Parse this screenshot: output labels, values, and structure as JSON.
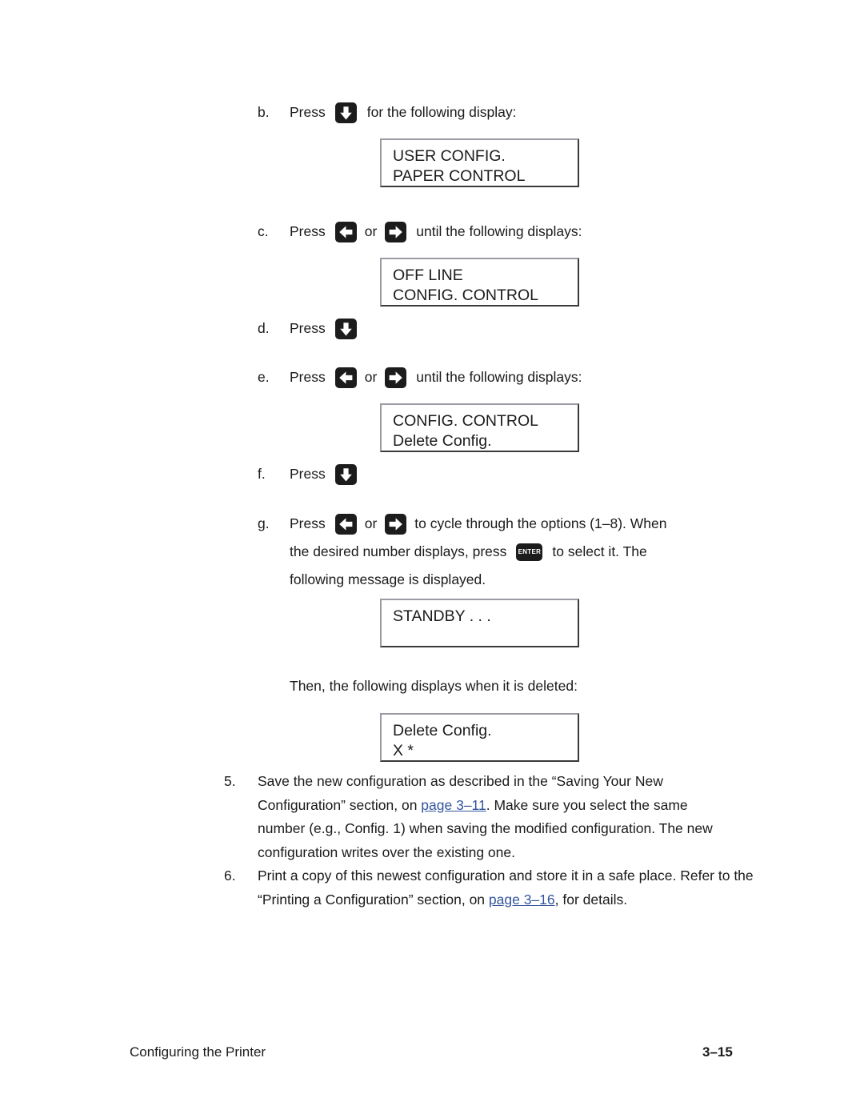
{
  "page": {
    "footer_left": "Configuring the Printer",
    "footer_right": "3–15"
  },
  "icons": {
    "down_arrow": "arrow-down-key-icon",
    "left_arrow": "arrow-left-key-icon",
    "right_arrow": "arrow-right-key-icon",
    "enter": "enter-key-icon",
    "enter_label": "ENTER"
  },
  "steps": {
    "b": {
      "marker": "b.",
      "text_before": "Press",
      "text_after": "for the following display:"
    },
    "c": {
      "marker": "c.",
      "text_before": "Press",
      "text_or": "or",
      "text_after": "until the following displays:"
    },
    "d": {
      "marker": "d.",
      "text_before": "Press"
    },
    "e": {
      "marker": "e.",
      "text_before": "Press",
      "text_or": "or",
      "text_after": "until the following displays:"
    },
    "f": {
      "marker": "f.",
      "text_before": "Press"
    },
    "g": {
      "marker": "g.",
      "text_before": "Press",
      "text_or": "or",
      "text_after": "to cycle through the options (1–8). When",
      "line2_before": "the desired number displays, press",
      "line2_after": "to select it. The",
      "line3": "following message is displayed."
    }
  },
  "displays": {
    "user_config": {
      "line1": "USER CONFIG.",
      "line2": "PAPER CONTROL"
    },
    "off_line": {
      "line1": "OFF LINE",
      "line2": "CONFIG. CONTROL"
    },
    "config_control": {
      "line1": "CONFIG. CONTROL",
      "line2": "Delete Config."
    },
    "standby": {
      "line1": "STANDBY . . .",
      "line2": ""
    },
    "delete_config": {
      "line1": "Delete Config.",
      "line2": "X *"
    }
  },
  "paragraphs": {
    "then_deleted": "Then, the following displays when it is deleted:"
  },
  "numbered": {
    "five": {
      "marker": "5.",
      "part1": "Save the new configuration as described in the “Saving Your New Configuration” section, on ",
      "link": "page 3–11",
      "part2": ". Make sure you select the same number (e.g., Config. 1) when saving the modified configuration. The new configuration writes over the existing one."
    },
    "six": {
      "marker": "6.",
      "part1": "Print a copy of this newest configuration and store it in a safe place. Refer to the “Printing a Configuration” section, on ",
      "link": "page 3–16",
      "part2": ", for details."
    }
  },
  "colors": {
    "link": "#33559e",
    "key_bg": "#1c1c1c",
    "box_border_light": "#9b9ba3",
    "box_border_dark": "#3a3a3a"
  }
}
